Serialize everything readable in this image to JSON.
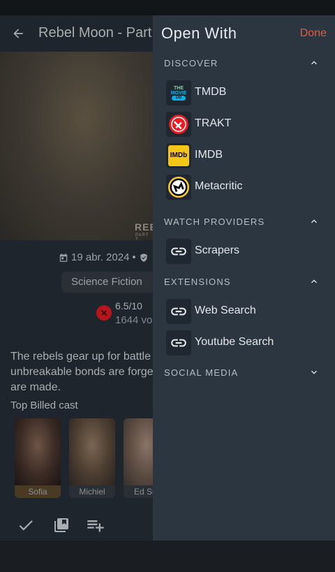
{
  "app": {
    "title": "Rebel Moon - Part",
    "poster_text": "REBE",
    "poster_subtext": "PART T",
    "release_date": "19 abr. 2024",
    "separator": "•",
    "genre": "Science Fiction",
    "rating": "6.5/10",
    "votes": "1644 vo",
    "overview": "The rebels gear up for battle... unbreakable bonds are forge... are made.",
    "overview_lines": [
      "The rebels gear up for battle",
      "unbreakable bonds are forge",
      "are made."
    ],
    "cast_heading": "Top Billed cast",
    "cast": [
      {
        "name": "Sofia"
      },
      {
        "name": "Michiel"
      },
      {
        "name": "Ed Skr"
      }
    ]
  },
  "drawer": {
    "title": "Open With",
    "done_label": "Done",
    "sections": [
      {
        "label": "DISCOVER",
        "expanded": true,
        "items": [
          {
            "label": "TMDB",
            "icon": "tmdb-logo"
          },
          {
            "label": "TRAKT",
            "icon": "trakt-logo"
          },
          {
            "label": "IMDB",
            "icon": "imdb-logo"
          },
          {
            "label": "Metacritic",
            "icon": "metacritic-logo"
          }
        ]
      },
      {
        "label": "WATCH PROVIDERS",
        "expanded": true,
        "items": [
          {
            "label": "Scrapers",
            "icon": "link-icon"
          }
        ]
      },
      {
        "label": "EXTENSIONS",
        "expanded": true,
        "items": [
          {
            "label": "Web Search",
            "icon": "link-icon"
          },
          {
            "label": "Youtube Search",
            "icon": "link-icon"
          }
        ]
      },
      {
        "label": "SOCIAL MEDIA",
        "expanded": false,
        "items": []
      }
    ]
  },
  "logos": {
    "tmdb_line1": "THE",
    "tmdb_line2": "MOVIE",
    "tmdb_line3": "DB",
    "imdb": "IMDb"
  },
  "colors": {
    "accent": "#e35a3c",
    "drawer_bg": "#2b3641",
    "imdb_yellow": "#f5c518",
    "trakt_red": "#ed1c24",
    "tmdb_teal": "#01b4e4"
  }
}
